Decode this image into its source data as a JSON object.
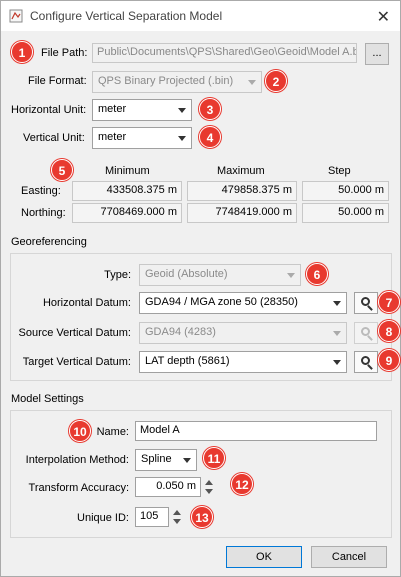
{
  "window": {
    "title": "Configure Vertical Separation Model"
  },
  "file": {
    "path_label": "File Path:",
    "path_value": "Public\\Documents\\QPS\\Shared\\Geo\\Geoid\\Model A.bin",
    "browse_label": "...",
    "format_label": "File Format:",
    "format_value": "QPS Binary Projected (.bin)",
    "horizontal_unit_label": "Horizontal Unit:",
    "horizontal_unit_value": "meter",
    "vertical_unit_label": "Vertical Unit:",
    "vertical_unit_value": "meter"
  },
  "extent": {
    "headers": [
      "Minimum",
      "Maximum",
      "Step"
    ],
    "rows": [
      {
        "label": "Easting:",
        "min": "433508.375 m",
        "max": "479858.375 m",
        "step": "50.000 m"
      },
      {
        "label": "Northing:",
        "min": "7708469.000 m",
        "max": "7748419.000 m",
        "step": "50.000 m"
      }
    ]
  },
  "georeferencing": {
    "title": "Georeferencing",
    "type_label": "Type:",
    "type_value": "Geoid (Absolute)",
    "horizontal_datum_label": "Horizontal Datum:",
    "horizontal_datum_value": "GDA94 / MGA zone 50 (28350)",
    "source_vertical_label": "Source Vertical Datum:",
    "source_vertical_value": "GDA94 (4283)",
    "target_vertical_label": "Target Vertical Datum:",
    "target_vertical_value": "LAT depth (5861)"
  },
  "model_settings": {
    "title": "Model Settings",
    "name_label": "Name:",
    "name_value": "Model A",
    "interp_label": "Interpolation Method:",
    "interp_value": "Spline",
    "accuracy_label": "Transform Accuracy:",
    "accuracy_value": "0.050 m",
    "unique_id_label": "Unique ID:",
    "unique_id_value": "105"
  },
  "buttons": {
    "ok": "OK",
    "cancel": "Cancel"
  },
  "badges": [
    "1",
    "2",
    "3",
    "4",
    "5",
    "6",
    "7",
    "8",
    "9",
    "10",
    "11",
    "12",
    "13"
  ],
  "colors": {
    "badge": "#e8392f",
    "default_button_border": "#0078d7"
  }
}
